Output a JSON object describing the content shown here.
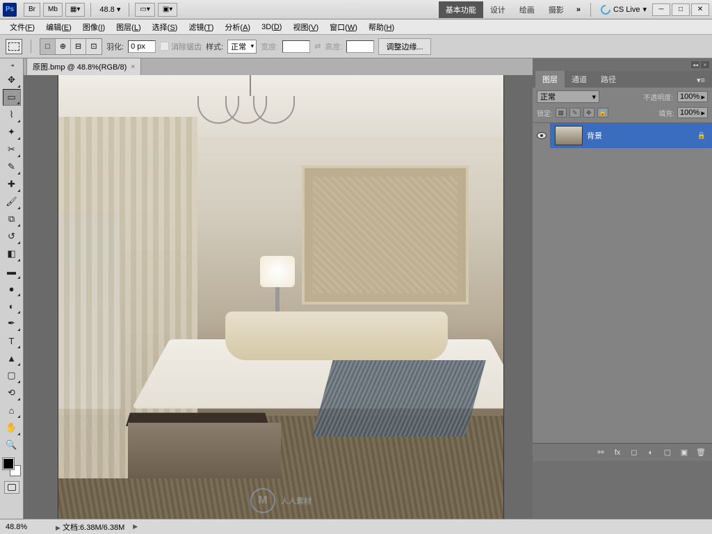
{
  "titlebar": {
    "logo": "Ps",
    "btn_br": "Br",
    "btn_mb": "Mb",
    "zoom": "48.8",
    "workspace_tabs": [
      "基本功能",
      "设计",
      "绘画",
      "摄影"
    ],
    "active_tab": 0,
    "more": "»",
    "cslive": "CS Live"
  },
  "menu": {
    "items": [
      {
        "label": "文件",
        "key": "F"
      },
      {
        "label": "编辑",
        "key": "E"
      },
      {
        "label": "图像",
        "key": "I"
      },
      {
        "label": "图层",
        "key": "L"
      },
      {
        "label": "选择",
        "key": "S"
      },
      {
        "label": "滤镜",
        "key": "T"
      },
      {
        "label": "分析",
        "key": "A"
      },
      {
        "label": "3D",
        "key": "D"
      },
      {
        "label": "视图",
        "key": "V"
      },
      {
        "label": "窗口",
        "key": "W"
      },
      {
        "label": "帮助",
        "key": "H"
      }
    ]
  },
  "options": {
    "feather_label": "羽化:",
    "feather_value": "0 px",
    "antialias": "消除锯齿",
    "style_label": "样式:",
    "style_value": "正常",
    "width_label": "宽度:",
    "height_label": "高度:",
    "refine": "调整边缘..."
  },
  "document": {
    "tab_title": "原图.bmp @ 48.8%(RGB/8)"
  },
  "canvas": {
    "watermark_text": "人人素材",
    "watermark_badge": "M"
  },
  "layers_panel": {
    "tabs": [
      "图层",
      "通道",
      "路径"
    ],
    "active_tab": 0,
    "blend_mode": "正常",
    "opacity_label": "不透明度:",
    "opacity_value": "100%",
    "lock_label": "锁定:",
    "fill_label": "填充:",
    "fill_value": "100%",
    "layers": [
      {
        "name": "背景",
        "visible": true,
        "locked": true
      }
    ]
  },
  "status": {
    "zoom": "48.8%",
    "doc_label": "文档:",
    "doc_size": "6.38M/6.38M"
  },
  "colors": {
    "selection_blue": "#3b6dbf",
    "panel_gray": "#838383"
  }
}
